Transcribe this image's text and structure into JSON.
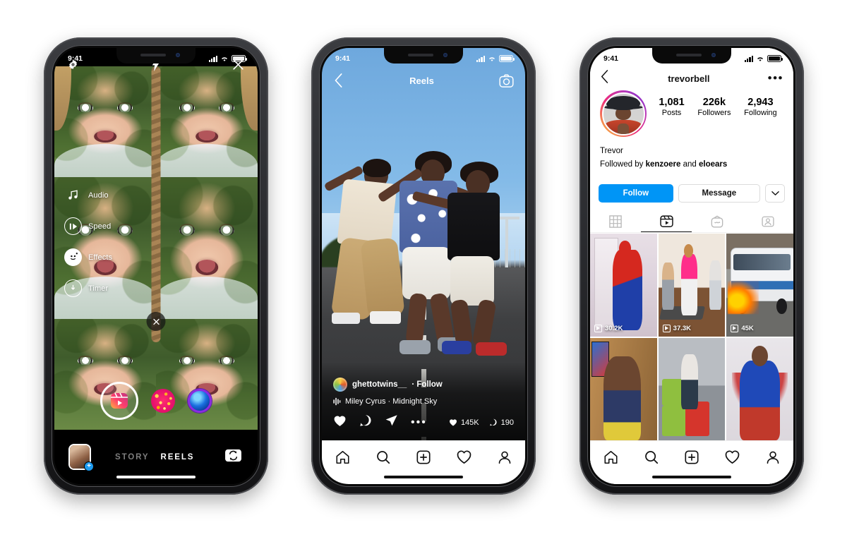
{
  "status_bar": {
    "time": "9:41",
    "signal_icon": "cellular-bars-icon",
    "wifi_icon": "wifi-icon",
    "battery_icon": "battery-icon"
  },
  "camera_phone": {
    "top_bar": {
      "settings_icon": "aperture-settings-icon",
      "flash_label": "x",
      "flash_icon": "flash-off-icon",
      "close_icon": "close-icon"
    },
    "tools": [
      {
        "label": "Audio",
        "icon": "music-note-icon"
      },
      {
        "label": "Speed",
        "icon": "speed-play-icon"
      },
      {
        "label": "Effects",
        "icon": "smiley-effects-icon"
      },
      {
        "label": "Timer",
        "icon": "timer-clock-icon"
      }
    ],
    "dismiss_icon": "close-circle-icon",
    "effects_carousel": [
      {
        "name": "reels-effect-default",
        "icon": "reels-glyph-icon"
      },
      {
        "name": "confetti-effect",
        "icon": "confetti-dot-icon"
      },
      {
        "name": "orb-effect",
        "icon": "blue-orb-icon"
      }
    ],
    "bottom_bar": {
      "gallery_icon": "gallery-thumbnail-icon",
      "gallery_badge": "+",
      "modes": [
        {
          "label": "STORY",
          "active": false
        },
        {
          "label": "REELS",
          "active": true
        }
      ],
      "flip_camera_icon": "flip-camera-icon"
    }
  },
  "reels_phone": {
    "header": {
      "back_icon": "chevron-left-icon",
      "title": "Reels",
      "camera_icon": "camera-icon"
    },
    "post": {
      "avatar_icon": "user-avatar-icon",
      "username": "ghettotwins__",
      "follow_label": "· Follow",
      "music_icon": "audio-waveform-icon",
      "music_text": "Miley Cyrus · Midnight Sky",
      "like_icon": "heart-icon",
      "comment_icon": "comment-bubble-icon",
      "share_icon": "paper-plane-icon",
      "more_icon": "more-dots-icon",
      "like_count": "145K",
      "comment_count": "190"
    },
    "tab_bar": [
      {
        "name": "home-tab",
        "icon": "home-icon"
      },
      {
        "name": "search-tab",
        "icon": "search-icon"
      },
      {
        "name": "create-tab",
        "icon": "plus-box-icon"
      },
      {
        "name": "activity-tab",
        "icon": "heart-icon"
      },
      {
        "name": "profile-tab",
        "icon": "person-icon"
      }
    ]
  },
  "profile_phone": {
    "nav": {
      "back_icon": "chevron-left-icon",
      "title": "trevorbell",
      "more_icon": "more-dots-icon"
    },
    "avatar_icon": "profile-avatar-icon",
    "stats": [
      {
        "num": "1,081",
        "label": "Posts"
      },
      {
        "num": "226k",
        "label": "Followers"
      },
      {
        "num": "2,943",
        "label": "Following"
      }
    ],
    "display_name": "Trevor",
    "followed_by": {
      "prefix": "Followed by ",
      "first": "kenzoere",
      "middle": " and ",
      "second": "eloears"
    },
    "actions": {
      "follow_label": "Follow",
      "message_label": "Message",
      "more_icon": "chevron-down-icon"
    },
    "tabs": [
      {
        "name": "grid-tab",
        "icon": "grid-icon",
        "active": false
      },
      {
        "name": "reels-tab",
        "icon": "reels-clapper-icon",
        "active": true
      },
      {
        "name": "igtv-tab",
        "icon": "igtv-icon",
        "active": false
      },
      {
        "name": "tagged-tab",
        "icon": "tagged-person-icon",
        "active": false
      }
    ],
    "grid": [
      {
        "id": "cell-spiderman",
        "views": "30.2K",
        "play_icon": "play-triangle-icon"
      },
      {
        "id": "cell-workout",
        "views": "37.3K",
        "play_icon": "play-triangle-icon"
      },
      {
        "id": "cell-bus",
        "views": "45K",
        "play_icon": "play-triangle-icon"
      },
      {
        "id": "cell-talking",
        "views": "",
        "play_icon": "play-triangle-icon"
      },
      {
        "id": "cell-boxjump",
        "views": "",
        "play_icon": "play-triangle-icon"
      },
      {
        "id": "cell-superman",
        "views": "",
        "play_icon": "play-triangle-icon"
      }
    ],
    "tab_bar": [
      {
        "name": "home-tab",
        "icon": "home-icon"
      },
      {
        "name": "search-tab",
        "icon": "search-icon"
      },
      {
        "name": "create-tab",
        "icon": "plus-box-icon"
      },
      {
        "name": "activity-tab",
        "icon": "heart-icon"
      },
      {
        "name": "profile-tab",
        "icon": "person-icon"
      }
    ]
  },
  "colors": {
    "instagram_blue": "#0095f6",
    "page_background": "#ffffff",
    "frame": "#2c2d31"
  }
}
